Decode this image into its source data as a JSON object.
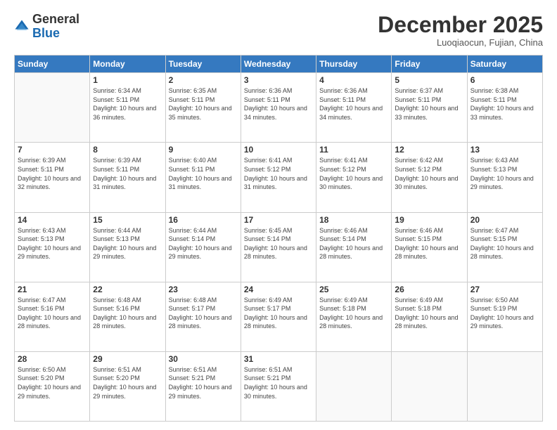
{
  "header": {
    "logo_general": "General",
    "logo_blue": "Blue",
    "month_title": "December 2025",
    "location": "Luoqiaocun, Fujian, China"
  },
  "weekdays": [
    "Sunday",
    "Monday",
    "Tuesday",
    "Wednesday",
    "Thursday",
    "Friday",
    "Saturday"
  ],
  "days": [
    {
      "day": "",
      "sunrise": "",
      "sunset": "",
      "daylight": ""
    },
    {
      "day": "1",
      "sunrise": "Sunrise: 6:34 AM",
      "sunset": "Sunset: 5:11 PM",
      "daylight": "Daylight: 10 hours and 36 minutes."
    },
    {
      "day": "2",
      "sunrise": "Sunrise: 6:35 AM",
      "sunset": "Sunset: 5:11 PM",
      "daylight": "Daylight: 10 hours and 35 minutes."
    },
    {
      "day": "3",
      "sunrise": "Sunrise: 6:36 AM",
      "sunset": "Sunset: 5:11 PM",
      "daylight": "Daylight: 10 hours and 34 minutes."
    },
    {
      "day": "4",
      "sunrise": "Sunrise: 6:36 AM",
      "sunset": "Sunset: 5:11 PM",
      "daylight": "Daylight: 10 hours and 34 minutes."
    },
    {
      "day": "5",
      "sunrise": "Sunrise: 6:37 AM",
      "sunset": "Sunset: 5:11 PM",
      "daylight": "Daylight: 10 hours and 33 minutes."
    },
    {
      "day": "6",
      "sunrise": "Sunrise: 6:38 AM",
      "sunset": "Sunset: 5:11 PM",
      "daylight": "Daylight: 10 hours and 33 minutes."
    },
    {
      "day": "7",
      "sunrise": "Sunrise: 6:39 AM",
      "sunset": "Sunset: 5:11 PM",
      "daylight": "Daylight: 10 hours and 32 minutes."
    },
    {
      "day": "8",
      "sunrise": "Sunrise: 6:39 AM",
      "sunset": "Sunset: 5:11 PM",
      "daylight": "Daylight: 10 hours and 31 minutes."
    },
    {
      "day": "9",
      "sunrise": "Sunrise: 6:40 AM",
      "sunset": "Sunset: 5:11 PM",
      "daylight": "Daylight: 10 hours and 31 minutes."
    },
    {
      "day": "10",
      "sunrise": "Sunrise: 6:41 AM",
      "sunset": "Sunset: 5:12 PM",
      "daylight": "Daylight: 10 hours and 31 minutes."
    },
    {
      "day": "11",
      "sunrise": "Sunrise: 6:41 AM",
      "sunset": "Sunset: 5:12 PM",
      "daylight": "Daylight: 10 hours and 30 minutes."
    },
    {
      "day": "12",
      "sunrise": "Sunrise: 6:42 AM",
      "sunset": "Sunset: 5:12 PM",
      "daylight": "Daylight: 10 hours and 30 minutes."
    },
    {
      "day": "13",
      "sunrise": "Sunrise: 6:43 AM",
      "sunset": "Sunset: 5:13 PM",
      "daylight": "Daylight: 10 hours and 29 minutes."
    },
    {
      "day": "14",
      "sunrise": "Sunrise: 6:43 AM",
      "sunset": "Sunset: 5:13 PM",
      "daylight": "Daylight: 10 hours and 29 minutes."
    },
    {
      "day": "15",
      "sunrise": "Sunrise: 6:44 AM",
      "sunset": "Sunset: 5:13 PM",
      "daylight": "Daylight: 10 hours and 29 minutes."
    },
    {
      "day": "16",
      "sunrise": "Sunrise: 6:44 AM",
      "sunset": "Sunset: 5:14 PM",
      "daylight": "Daylight: 10 hours and 29 minutes."
    },
    {
      "day": "17",
      "sunrise": "Sunrise: 6:45 AM",
      "sunset": "Sunset: 5:14 PM",
      "daylight": "Daylight: 10 hours and 28 minutes."
    },
    {
      "day": "18",
      "sunrise": "Sunrise: 6:46 AM",
      "sunset": "Sunset: 5:14 PM",
      "daylight": "Daylight: 10 hours and 28 minutes."
    },
    {
      "day": "19",
      "sunrise": "Sunrise: 6:46 AM",
      "sunset": "Sunset: 5:15 PM",
      "daylight": "Daylight: 10 hours and 28 minutes."
    },
    {
      "day": "20",
      "sunrise": "Sunrise: 6:47 AM",
      "sunset": "Sunset: 5:15 PM",
      "daylight": "Daylight: 10 hours and 28 minutes."
    },
    {
      "day": "21",
      "sunrise": "Sunrise: 6:47 AM",
      "sunset": "Sunset: 5:16 PM",
      "daylight": "Daylight: 10 hours and 28 minutes."
    },
    {
      "day": "22",
      "sunrise": "Sunrise: 6:48 AM",
      "sunset": "Sunset: 5:16 PM",
      "daylight": "Daylight: 10 hours and 28 minutes."
    },
    {
      "day": "23",
      "sunrise": "Sunrise: 6:48 AM",
      "sunset": "Sunset: 5:17 PM",
      "daylight": "Daylight: 10 hours and 28 minutes."
    },
    {
      "day": "24",
      "sunrise": "Sunrise: 6:49 AM",
      "sunset": "Sunset: 5:17 PM",
      "daylight": "Daylight: 10 hours and 28 minutes."
    },
    {
      "day": "25",
      "sunrise": "Sunrise: 6:49 AM",
      "sunset": "Sunset: 5:18 PM",
      "daylight": "Daylight: 10 hours and 28 minutes."
    },
    {
      "day": "26",
      "sunrise": "Sunrise: 6:49 AM",
      "sunset": "Sunset: 5:18 PM",
      "daylight": "Daylight: 10 hours and 28 minutes."
    },
    {
      "day": "27",
      "sunrise": "Sunrise: 6:50 AM",
      "sunset": "Sunset: 5:19 PM",
      "daylight": "Daylight: 10 hours and 29 minutes."
    },
    {
      "day": "28",
      "sunrise": "Sunrise: 6:50 AM",
      "sunset": "Sunset: 5:20 PM",
      "daylight": "Daylight: 10 hours and 29 minutes."
    },
    {
      "day": "29",
      "sunrise": "Sunrise: 6:51 AM",
      "sunset": "Sunset: 5:20 PM",
      "daylight": "Daylight: 10 hours and 29 minutes."
    },
    {
      "day": "30",
      "sunrise": "Sunrise: 6:51 AM",
      "sunset": "Sunset: 5:21 PM",
      "daylight": "Daylight: 10 hours and 29 minutes."
    },
    {
      "day": "31",
      "sunrise": "Sunrise: 6:51 AM",
      "sunset": "Sunset: 5:21 PM",
      "daylight": "Daylight: 10 hours and 30 minutes."
    },
    {
      "day": "",
      "sunrise": "",
      "sunset": "",
      "daylight": ""
    },
    {
      "day": "",
      "sunrise": "",
      "sunset": "",
      "daylight": ""
    },
    {
      "day": "",
      "sunrise": "",
      "sunset": "",
      "daylight": ""
    },
    {
      "day": "",
      "sunrise": "",
      "sunset": "",
      "daylight": ""
    }
  ]
}
